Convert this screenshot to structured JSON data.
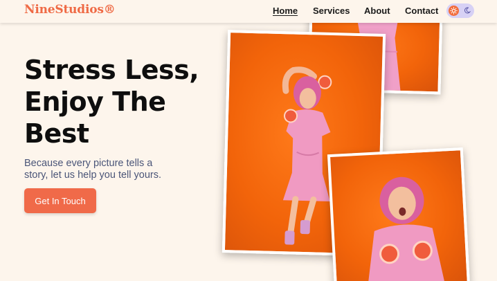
{
  "brand": {
    "logo_text": "NineStudios®",
    "accent_color": "#ef6a45"
  },
  "nav": {
    "items": [
      {
        "label": "Home",
        "active": true
      },
      {
        "label": "Services",
        "active": false
      },
      {
        "label": "About",
        "active": false
      },
      {
        "label": "Contact",
        "active": false
      }
    ],
    "theme_toggle": {
      "light_icon": "sun-icon",
      "dark_icon": "moon-icon",
      "mode": "light"
    }
  },
  "hero": {
    "title_lines": [
      "Stress Less,",
      "Enjoy The",
      "Best"
    ],
    "subtitle_lines": [
      "Because every picture tells a",
      "story, let us help you tell yours."
    ],
    "cta_label": "Get In Touch",
    "cta_color": "#f06a49"
  },
  "gallery": {
    "photos": [
      {
        "name": "photo-top",
        "background": "#f2640a"
      },
      {
        "name": "photo-main",
        "background": "#f2640a"
      },
      {
        "name": "photo-bottom",
        "background": "#f2640a"
      }
    ]
  }
}
